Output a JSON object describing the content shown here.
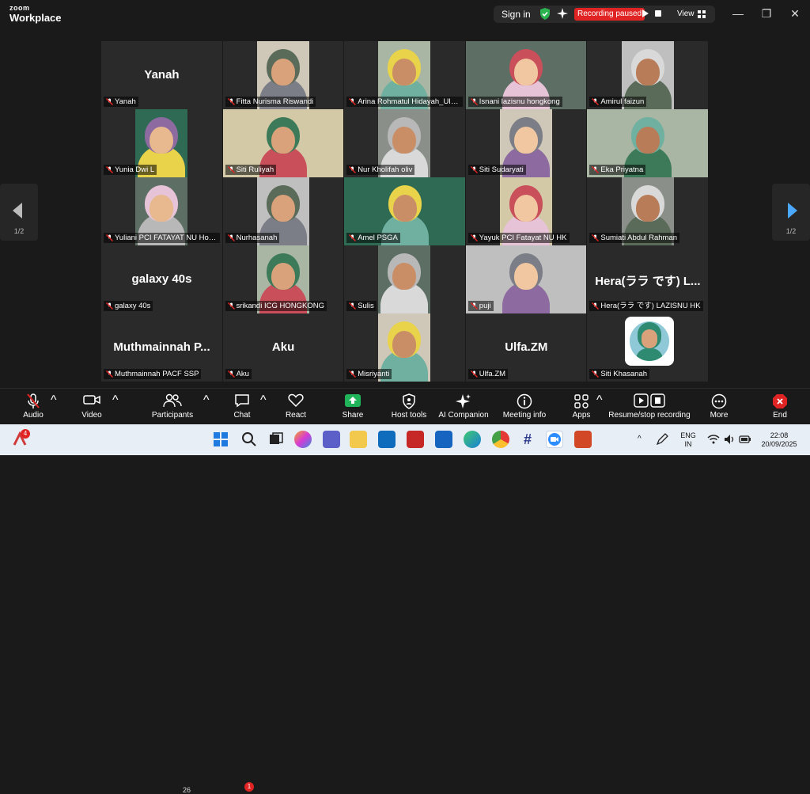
{
  "app": {
    "brand_small": "zoom",
    "brand_big": "Workplace"
  },
  "titlebar": {
    "signin": "Sign in",
    "recording": "Recording paused",
    "view": "View",
    "icons": [
      "shield-icon",
      "sparkle-icon",
      "play-icon",
      "stop-icon",
      "grid-icon"
    ],
    "window_controls": [
      "—",
      "❐",
      "✕"
    ]
  },
  "nav": {
    "left_page": "1/2",
    "right_page": "1/2"
  },
  "participants": [
    {
      "name": "Yanah",
      "display": "Yanah",
      "video": false
    },
    {
      "name": "Fitta Nurisma Riswandi",
      "video": true
    },
    {
      "name": "Arina Rohmatul Hidayah_UIT Lir...",
      "video": true
    },
    {
      "name": "Isnani lazisnu hongkong",
      "video": true
    },
    {
      "name": "Amirul faizun",
      "video": true
    },
    {
      "name": "Yunia Dwi L",
      "video": true
    },
    {
      "name": "Siti Ruliyah",
      "video": true
    },
    {
      "name": "Nur Kholifah oliv",
      "video": true
    },
    {
      "name": "Siti Sudaryati",
      "video": true
    },
    {
      "name": "Eka Priyatna",
      "video": true
    },
    {
      "name": "Yuliani PCI FATAYAT NU Hon...",
      "video": true
    },
    {
      "name": "Nurhasanah",
      "video": true
    },
    {
      "name": "Amel PSGA",
      "video": true,
      "active": true
    },
    {
      "name": "Yayuk PCI Fatayat NU HK",
      "video": true
    },
    {
      "name": "Sumiati Abdul Rahman",
      "video": true
    },
    {
      "name": "galaxy 40s",
      "display": "galaxy 40s",
      "video": false
    },
    {
      "name": "srikandi ICG HONGKONG",
      "video": true
    },
    {
      "name": "Sulis",
      "video": true
    },
    {
      "name": "puji",
      "video": true
    },
    {
      "name": "Hera(ララ です) LAZISNU HK",
      "display": "Hera(ララ です) L...",
      "video": false
    },
    {
      "name": "Muthmainnah PACF SSP",
      "display": "Muthmainnah  P...",
      "video": false
    },
    {
      "name": "Aku",
      "display": "Aku",
      "video": false
    },
    {
      "name": "Misriyanti",
      "video": true
    },
    {
      "name": "Ulfa.ZM",
      "display": "Ulfa.ZM",
      "video": false
    },
    {
      "name": "Siti Khasanah",
      "video": false,
      "avatar": true
    }
  ],
  "toolbar": {
    "audio": "Audio",
    "video": "Video",
    "participants": "Participants",
    "participants_count": "26",
    "chat": "Chat",
    "chat_badge": "1",
    "react": "React",
    "share": "Share",
    "host_tools": "Host tools",
    "ai_companion": "AI Companion",
    "meeting_info": "Meeting info",
    "apps": "Apps",
    "recording": "Resume/stop recording",
    "more": "More",
    "end": "End"
  },
  "taskbar": {
    "notif_badge": "4",
    "lang_top": "ENG",
    "lang_bottom": "IN",
    "time": "22:08",
    "date": "20/09/2025"
  },
  "colors": {
    "accent": "#3dd56d",
    "record": "#e02424",
    "share": "#1fb45a",
    "end": "#e02424",
    "taskbar": "#e8eef6"
  }
}
